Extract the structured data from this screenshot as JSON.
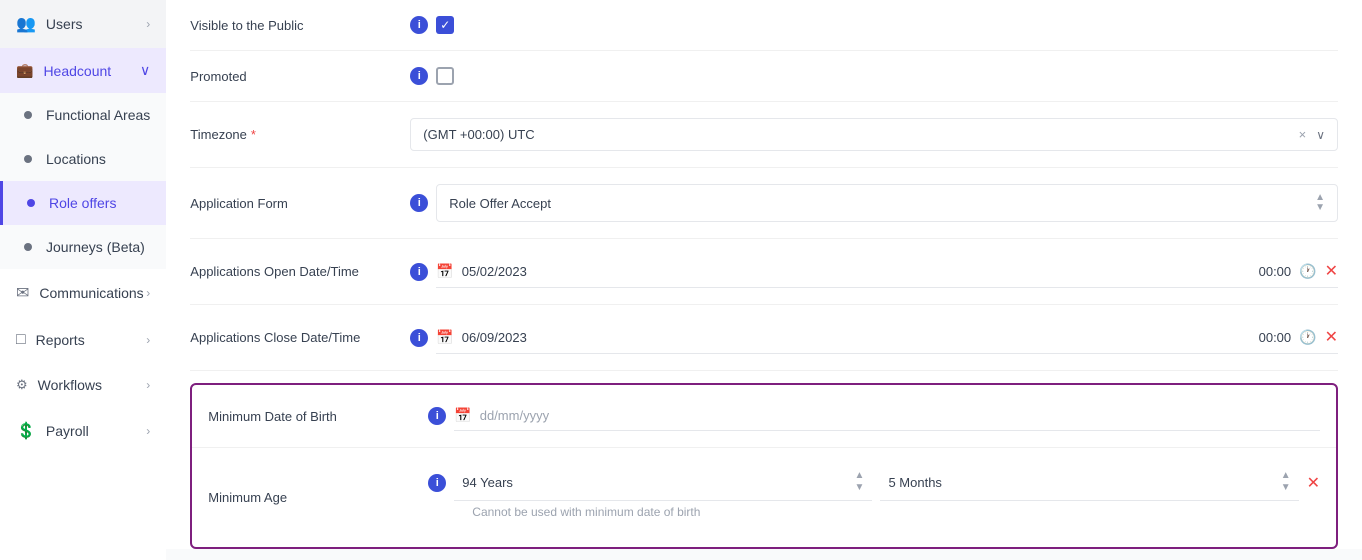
{
  "sidebar": {
    "items": [
      {
        "id": "users",
        "label": "Users",
        "icon": "👥",
        "hasChevron": true,
        "active": false
      },
      {
        "id": "headcount",
        "label": "Headcount",
        "icon": "💼",
        "hasChevron": true,
        "active": true,
        "expanded": true
      },
      {
        "id": "functional-areas",
        "label": "Functional Areas",
        "dot": true,
        "active": false
      },
      {
        "id": "locations",
        "label": "Locations",
        "dot": true,
        "active": false
      },
      {
        "id": "role-offers",
        "label": "Role offers",
        "dot": true,
        "active": true
      },
      {
        "id": "journeys",
        "label": "Journeys (Beta)",
        "dot": true,
        "active": false
      },
      {
        "id": "communications",
        "label": "Communications",
        "icon": "✉",
        "hasChevron": true,
        "active": false
      },
      {
        "id": "reports",
        "label": "Reports",
        "icon": "📄",
        "hasChevron": true,
        "active": false
      },
      {
        "id": "workflows",
        "label": "Workflows",
        "icon": "🔗",
        "hasChevron": true,
        "active": false
      },
      {
        "id": "payroll",
        "label": "Payroll",
        "icon": "💲",
        "hasChevron": true,
        "active": false
      }
    ]
  },
  "form": {
    "fields": {
      "visible_to_public": {
        "label": "Visible to the Public",
        "checked": true
      },
      "promoted": {
        "label": "Promoted",
        "checked": false
      },
      "timezone": {
        "label": "Timezone",
        "required": true,
        "value": "(GMT +00:00) UTC"
      },
      "application_form": {
        "label": "Application Form",
        "value": "Role Offer Accept"
      },
      "applications_open": {
        "label": "Applications Open Date/Time",
        "date": "05/02/2023",
        "time": "00:00"
      },
      "applications_close": {
        "label": "Applications Close Date/Time",
        "date": "06/09/2023",
        "time": "00:00"
      },
      "min_date_of_birth": {
        "label": "Minimum Date of Birth",
        "placeholder": "dd/mm/yyyy"
      },
      "min_age": {
        "label": "Minimum Age",
        "years_value": "94 Years",
        "months_value": "5 Months",
        "hint": "Cannot be used with minimum date of birth"
      }
    }
  }
}
